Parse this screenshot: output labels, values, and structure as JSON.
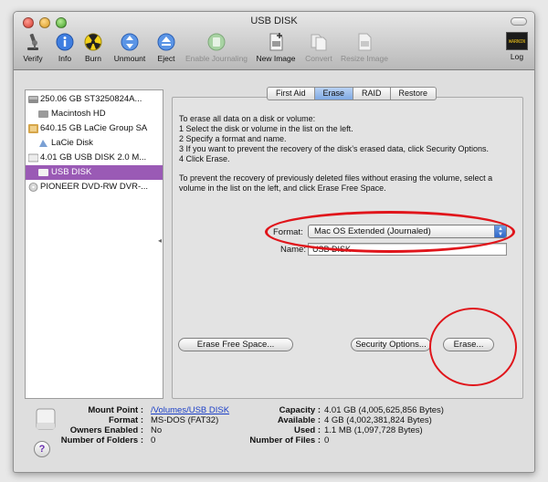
{
  "window": {
    "title": "USB DISK"
  },
  "toolbar": {
    "verify": "Verify",
    "info": "Info",
    "burn": "Burn",
    "unmount": "Unmount",
    "eject": "Eject",
    "enable_journaling": "Enable Journaling",
    "new_image": "New Image",
    "convert": "Convert",
    "resize_image": "Resize Image",
    "log": "Log",
    "log_badge": "WARNIN"
  },
  "sidebar": {
    "items": [
      {
        "label": "250.06 GB ST3250824A...",
        "icon": "internal-disk-icon"
      },
      {
        "label": "Macintosh HD",
        "icon": "volume-icon"
      },
      {
        "label": "640.15 GB LaCie Group SA",
        "icon": "external-disk-icon"
      },
      {
        "label": "LaCie Disk",
        "icon": "volume-icon"
      },
      {
        "label": "4.01 GB USB DISK 2.0 M...",
        "icon": "usb-disk-icon"
      },
      {
        "label": "USB DISK",
        "icon": "volume-icon",
        "selected": true
      },
      {
        "label": "PIONEER DVD-RW DVR-...",
        "icon": "optical-drive-icon"
      }
    ]
  },
  "tabs": [
    {
      "label": "First Aid"
    },
    {
      "label": "Erase",
      "active": true
    },
    {
      "label": "RAID"
    },
    {
      "label": "Restore"
    }
  ],
  "erase": {
    "instructions": [
      "To erase all data on a disk or volume:",
      "1  Select the disk or volume in the list on the left.",
      "2  Specify a format and name.",
      "3  If you want to prevent the recovery of the disk’s erased data, click Security Options.",
      "4  Click Erase."
    ],
    "free_space_instructions": [
      "To prevent the recovery of previously deleted files without erasing the volume, select a",
      "volume in the list on the left, and click Erase Free Space."
    ],
    "format_label": "Format:",
    "format_value": "Mac OS Extended (Journaled)",
    "name_label": "Name:",
    "name_value": "USB DISK",
    "erase_free_space_button": "Erase Free Space...",
    "security_options_button": "Security Options...",
    "erase_button": "Erase..."
  },
  "info": {
    "mount_point_label": "Mount Point :",
    "mount_point_value": "/Volumes/USB DISK",
    "format_label": "Format :",
    "format_value": "MS-DOS (FAT32)",
    "owners_enabled_label": "Owners Enabled :",
    "owners_enabled_value": "No",
    "folders_label": "Number of Folders :",
    "folders_value": "0",
    "capacity_label": "Capacity :",
    "capacity_value": "4.01 GB (4,005,625,856 Bytes)",
    "available_label": "Available :",
    "available_value": "4 GB (4,002,381,824 Bytes)",
    "used_label": "Used :",
    "used_value": "1.1 MB (1,097,728 Bytes)",
    "files_label": "Number of Files :",
    "files_value": "0"
  },
  "help_glyph": "?",
  "colors": {
    "selection": "#9a5ab5",
    "annotation": "#e0151b",
    "link": "#1b3fc7"
  }
}
